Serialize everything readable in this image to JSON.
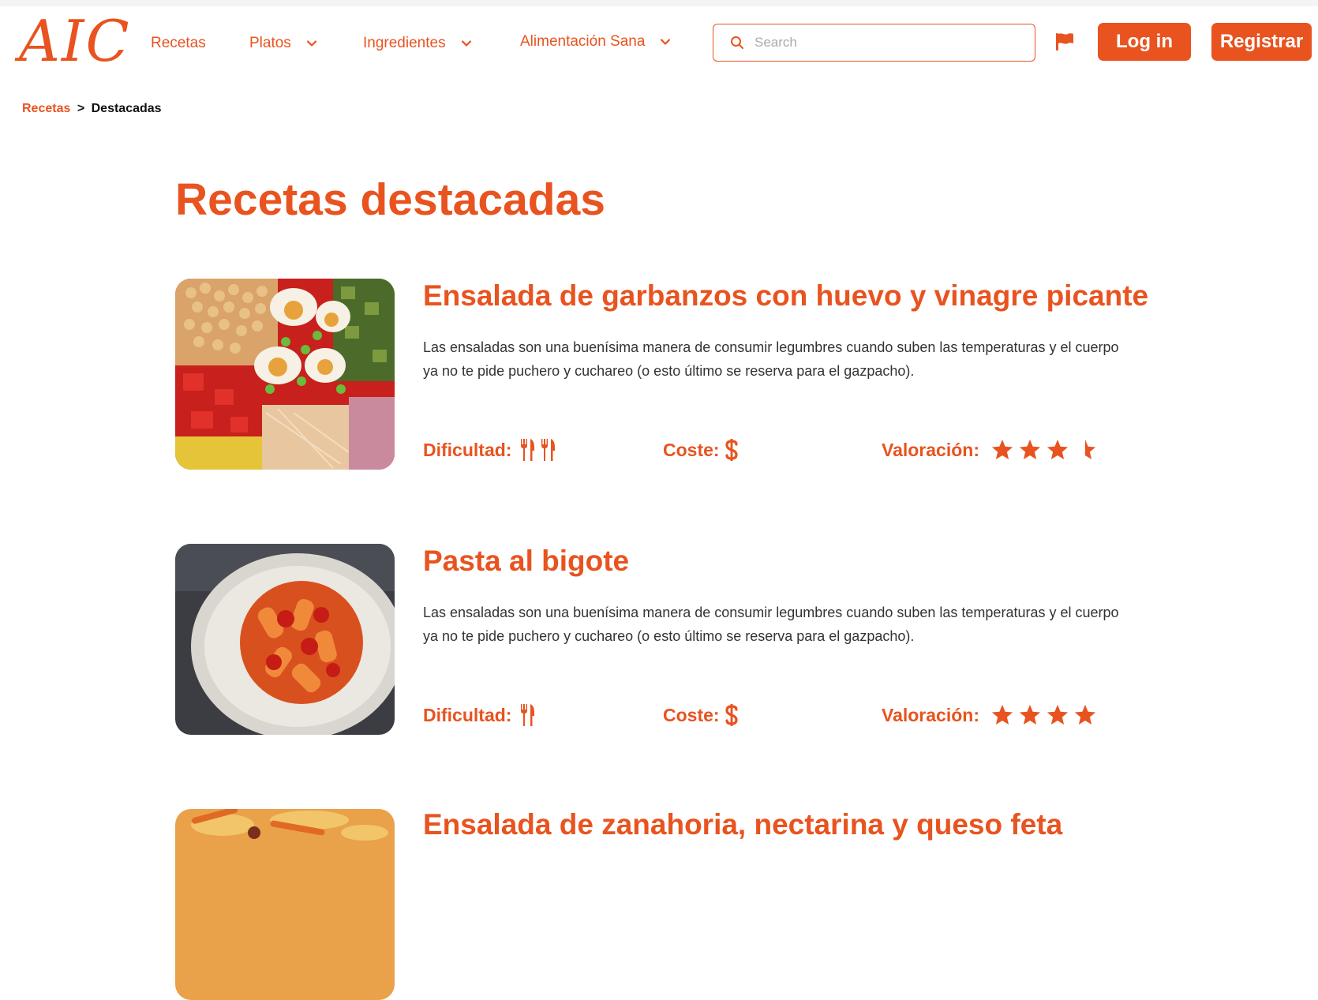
{
  "brand": {
    "logo": "AIC",
    "accent": "#e8531f"
  },
  "nav": {
    "items": [
      {
        "label": "Recetas",
        "dropdown": false
      },
      {
        "label": "Platos",
        "dropdown": true
      },
      {
        "label": "Ingredientes",
        "dropdown": true
      },
      {
        "label": "Alimentación Sana",
        "dropdown": true
      }
    ]
  },
  "search": {
    "placeholder": "Search",
    "value": ""
  },
  "header_icons": {
    "flag": "flag-icon",
    "search": "search-icon"
  },
  "auth": {
    "login_label": "Log in",
    "register_label": "Registrar"
  },
  "breadcrumb": {
    "root": "Recetas",
    "separator": ">",
    "current": "Destacadas"
  },
  "page": {
    "title": "Recetas destacadas"
  },
  "labels": {
    "difficulty": "Dificultad:",
    "cost": "Coste:",
    "rating": "Valoración:"
  },
  "recipes": [
    {
      "title": "Ensalada de garbanzos con huevo y vinagre picante",
      "description": "Las ensaladas son una buenísima manera de consumir legumbres cuando suben las temperaturas y el cuerpo ya no te pide puchero y cuchareo (o esto último se reserva para el gazpacho).",
      "difficulty": 2,
      "cost": 1,
      "rating": 3.5
    },
    {
      "title": "Pasta al bigote",
      "description": "Las ensaladas son una buenísima manera de consumir legumbres cuando suben las temperaturas y el cuerpo ya no te pide puchero y cuchareo (o esto último se reserva para el gazpacho).",
      "difficulty": 1,
      "cost": 1,
      "rating": 4
    },
    {
      "title": "Ensalada de zanahoria, nectarina y queso feta"
    }
  ]
}
